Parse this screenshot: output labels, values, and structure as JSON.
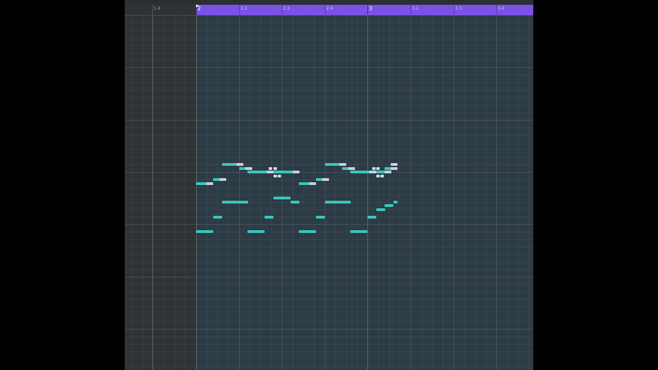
{
  "ruler": {
    "labels_left": [
      "1.4"
    ],
    "labels_right": [
      "2",
      "2.2",
      "2.3",
      "2.4",
      "3",
      "3.2",
      "3.3",
      "3.4"
    ]
  },
  "colors": {
    "ruler_active": "#7a52e6",
    "grid_bg": "#2d3b45",
    "note": "#39c7bf",
    "note_tail": "#c7d1dc"
  },
  "notes": [
    {
      "row": 8,
      "start": 0.0,
      "len": 0.4,
      "tail": true
    },
    {
      "row": 7,
      "start": 0.4,
      "len": 0.3,
      "tail": true
    },
    {
      "row": 3,
      "start": 0.6,
      "len": 0.5,
      "tail": true
    },
    {
      "row": 4,
      "start": 1.0,
      "len": 0.3,
      "tail": true
    },
    {
      "row": 5,
      "start": 1.2,
      "len": 0.6,
      "tail": true
    },
    {
      "row": 4,
      "start": 1.7,
      "len": 0.05,
      "tail": false
    },
    {
      "row": 4,
      "start": 1.8,
      "len": 0.05,
      "tail": false
    },
    {
      "row": 6,
      "start": 1.8,
      "len": 0.05,
      "tail": false
    },
    {
      "row": 6,
      "start": 1.9,
      "len": 0.05,
      "tail": false
    },
    {
      "row": 5,
      "start": 1.8,
      "len": 0.6,
      "tail": true
    },
    {
      "row": 8,
      "start": 2.4,
      "len": 0.4,
      "tail": true
    },
    {
      "row": 7,
      "start": 2.8,
      "len": 0.3,
      "tail": true
    },
    {
      "row": 3,
      "start": 3.0,
      "len": 0.5,
      "tail": true
    },
    {
      "row": 4,
      "start": 3.4,
      "len": 0.3,
      "tail": true
    },
    {
      "row": 5,
      "start": 3.6,
      "len": 0.6,
      "tail": true
    },
    {
      "row": 4,
      "start": 4.1,
      "len": 0.05,
      "tail": false
    },
    {
      "row": 4,
      "start": 4.2,
      "len": 0.05,
      "tail": false
    },
    {
      "row": 6,
      "start": 4.2,
      "len": 0.05,
      "tail": false
    },
    {
      "row": 6,
      "start": 4.3,
      "len": 0.05,
      "tail": false
    },
    {
      "row": 5,
      "start": 4.2,
      "len": 0.35,
      "tail": true
    },
    {
      "row": 4,
      "start": 4.4,
      "len": 0.3,
      "tail": true
    },
    {
      "row": 3,
      "start": 4.6,
      "len": 0.1,
      "tail": true
    },
    {
      "row": 13,
      "start": 0.6,
      "len": 0.6,
      "tail": false
    },
    {
      "row": 12,
      "start": 1.8,
      "len": 0.4,
      "tail": false
    },
    {
      "row": 13,
      "start": 2.2,
      "len": 0.2,
      "tail": false
    },
    {
      "row": 13,
      "start": 3.0,
      "len": 0.6,
      "tail": false
    },
    {
      "row": 15,
      "start": 4.2,
      "len": 0.2,
      "tail": false
    },
    {
      "row": 14,
      "start": 4.4,
      "len": 0.2,
      "tail": false
    },
    {
      "row": 13,
      "start": 4.6,
      "len": 0.1,
      "tail": false
    },
    {
      "row": 17,
      "start": 0.4,
      "len": 0.2,
      "tail": false
    },
    {
      "row": 17,
      "start": 1.6,
      "len": 0.2,
      "tail": false
    },
    {
      "row": 17,
      "start": 2.8,
      "len": 0.2,
      "tail": false
    },
    {
      "row": 17,
      "start": 4.0,
      "len": 0.2,
      "tail": false
    },
    {
      "row": 21,
      "start": 0.0,
      "len": 0.4,
      "tail": false
    },
    {
      "row": 21,
      "start": 1.2,
      "len": 0.4,
      "tail": false
    },
    {
      "row": 21,
      "start": 2.4,
      "len": 0.4,
      "tail": false
    },
    {
      "row": 21,
      "start": 3.6,
      "len": 0.4,
      "tail": false
    }
  ]
}
